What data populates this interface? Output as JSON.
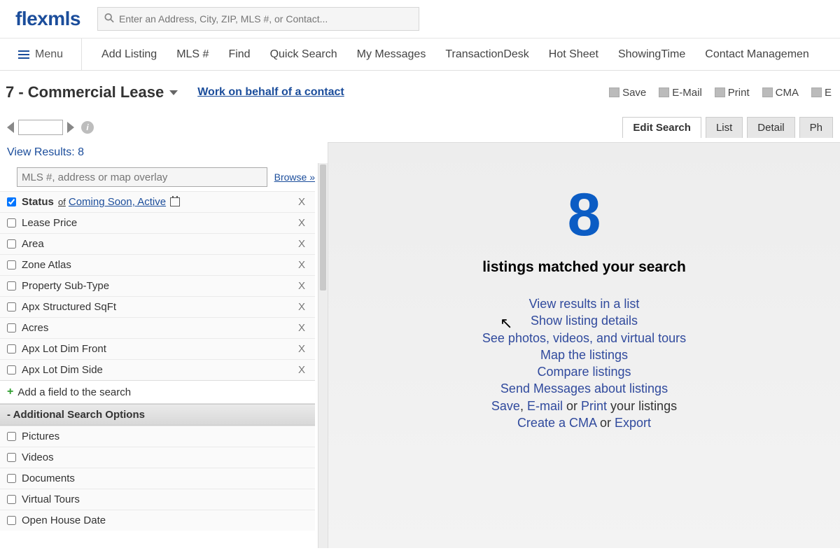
{
  "brand": "flexmls",
  "search_placeholder": "Enter an Address, City, ZIP, MLS #, or Contact...",
  "menu_label": "Menu",
  "nav": [
    "Add Listing",
    "MLS #",
    "Find",
    "Quick Search",
    "My Messages",
    "TransactionDesk",
    "Hot Sheet",
    "ShowingTime",
    "Contact Managemen"
  ],
  "context_title": "7 - Commercial Lease",
  "behalf_link": "Work on behalf of a contact",
  "actions": {
    "save": "Save",
    "email": "E-Mail",
    "print": "Print",
    "cma": "CMA",
    "export": "E"
  },
  "tabs": {
    "edit": "Edit Search",
    "list": "List",
    "detail": "Detail",
    "photos": "Ph"
  },
  "view_results_label": "View Results:",
  "view_results_count": "8",
  "mls_placeholder": "MLS #, address or map overlay",
  "browse": "Browse »",
  "fields": {
    "status_label": "Status",
    "status_of": "of",
    "status_values": "Coming Soon, Active",
    "items": [
      "Lease Price",
      "Area",
      "Zone Atlas",
      "Property Sub-Type",
      "Apx Structured SqFt",
      "Acres",
      "Apx Lot Dim Front",
      "Apx Lot Dim Side"
    ]
  },
  "add_field": "Add a field to the search",
  "additional_header": "- Additional Search Options",
  "additional": [
    "Pictures",
    "Videos",
    "Documents",
    "Virtual Tours",
    "Open House Date"
  ],
  "results": {
    "count": "8",
    "matched": "listings matched your search",
    "l1": "View results in a list",
    "l2": "Show listing details",
    "l3": "See photos, videos, and virtual tours",
    "l4": "Map the listings",
    "l5": "Compare listings",
    "l6": "Send Messages about listings",
    "l7a": "Save",
    "l7b": "E-mail",
    "l7or": "or",
    "l7c": "Print",
    "l7d": "your listings",
    "l8a": "Create a CMA",
    "l8or": "or",
    "l8b": "Export"
  }
}
